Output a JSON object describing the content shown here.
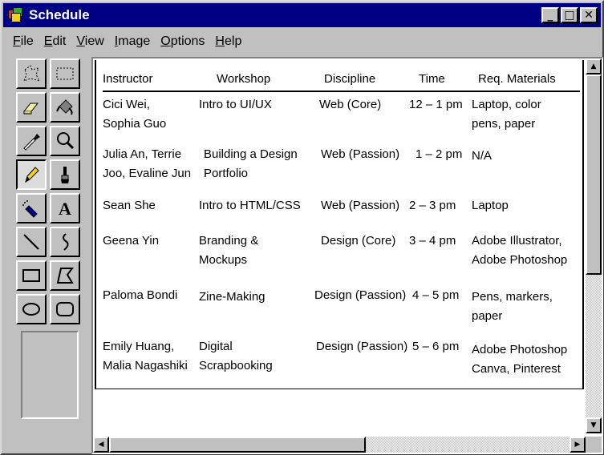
{
  "window": {
    "title": "Schedule",
    "buttons": {
      "minimize": "_",
      "maximize": "□",
      "close": "✕"
    }
  },
  "menu": [
    {
      "mnemonic": "F",
      "rest": "ile"
    },
    {
      "mnemonic": "E",
      "rest": "dit"
    },
    {
      "mnemonic": "V",
      "rest": "iew"
    },
    {
      "mnemonic": "I",
      "rest": "mage"
    },
    {
      "mnemonic": "O",
      "rest": "ptions"
    },
    {
      "mnemonic": "H",
      "rest": "elp"
    }
  ],
  "tools": [
    "free-select-icon",
    "rect-select-icon",
    "eraser-icon",
    "fill-bucket-icon",
    "color-picker-icon",
    "magnifier-icon",
    "pencil-icon",
    "brush-icon",
    "airbrush-icon",
    "text-icon",
    "line-icon",
    "curve-icon",
    "rectangle-icon",
    "polygon-icon",
    "ellipse-icon",
    "rounded-rect-icon"
  ],
  "table": {
    "headers": [
      "Instructor",
      "Workshop",
      "Discipline",
      "Time",
      "Req. Materials"
    ],
    "rows": [
      {
        "instructor": [
          "Cici Wei,",
          "Sophia Guo"
        ],
        "workshop": [
          "Intro to UI/UX"
        ],
        "discipline": "Web (Core)",
        "time": "12 – 1 pm",
        "materials": [
          "Laptop, color",
          "pens, paper"
        ]
      },
      {
        "instructor": [
          "Julia An, Terrie",
          "Joo, Evaline Jun"
        ],
        "workshop": [
          "Building a Design",
          "Portfolio"
        ],
        "discipline": "Web (Passion)",
        "time": "1 – 2 pm",
        "materials": [
          "N/A"
        ]
      },
      {
        "instructor": [
          "Sean She"
        ],
        "workshop": [
          "Intro to HTML/CSS"
        ],
        "discipline": "Web (Passion)",
        "time": "2 – 3 pm",
        "materials": [
          "Laptop"
        ]
      },
      {
        "instructor": [
          "Geena Yin"
        ],
        "workshop": [
          "Branding &",
          "Mockups"
        ],
        "discipline": "Design (Core)",
        "time": "3 – 4 pm",
        "materials": [
          "Adobe Illustrator,",
          "Adobe Photoshop"
        ]
      },
      {
        "instructor": [
          "Paloma Bondi"
        ],
        "workshop": [
          "Zine-Making"
        ],
        "discipline": "Design (Passion)",
        "time": "4 – 5 pm",
        "materials": [
          "Pens, markers,",
          "paper"
        ]
      },
      {
        "instructor": [
          "Emily Huang,",
          "Malia Nagashiki"
        ],
        "workshop": [
          "Digital",
          "Scrapbooking"
        ],
        "discipline": "Design (Passion)",
        "time": "5 – 6 pm",
        "materials": [
          "Adobe Photoshop",
          "Canva, Pinterest"
        ]
      }
    ]
  },
  "scroll": {
    "up": "▲",
    "down": "▼",
    "left": "◀",
    "right": "▶"
  },
  "colors": {
    "titlebar": "#000084",
    "face": "#c0c0c0"
  }
}
